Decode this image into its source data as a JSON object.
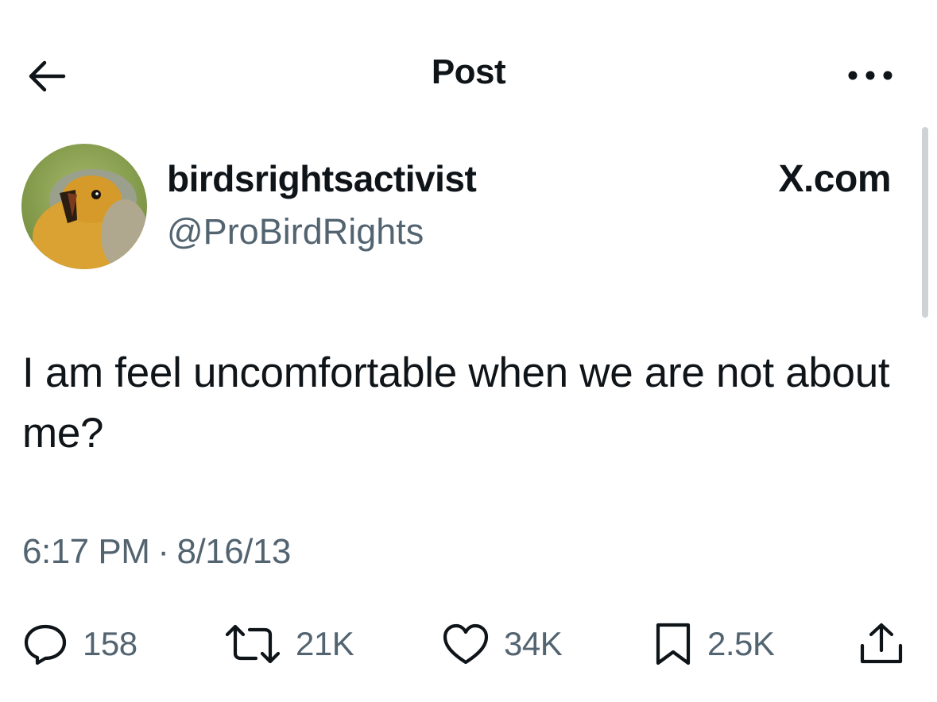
{
  "header": {
    "title": "Post",
    "back_icon": "arrow-left-icon",
    "more_icon": "more-horizontal-icon"
  },
  "author": {
    "display_name": "birdsrightsactivist",
    "handle": "@ProBirdRights",
    "avatar": "robin-bird-avatar"
  },
  "source_label": "X.com",
  "post": {
    "text": "I am feel uncomfortable when we are not about me?",
    "time": "6:17 PM",
    "separator": "·",
    "date": "8/16/13"
  },
  "actions": {
    "replies": "158",
    "reposts": "21K",
    "likes": "34K",
    "bookmarks": "2.5K"
  },
  "colors": {
    "text_primary": "#0f1419",
    "text_secondary": "#536471",
    "background": "#ffffff"
  }
}
